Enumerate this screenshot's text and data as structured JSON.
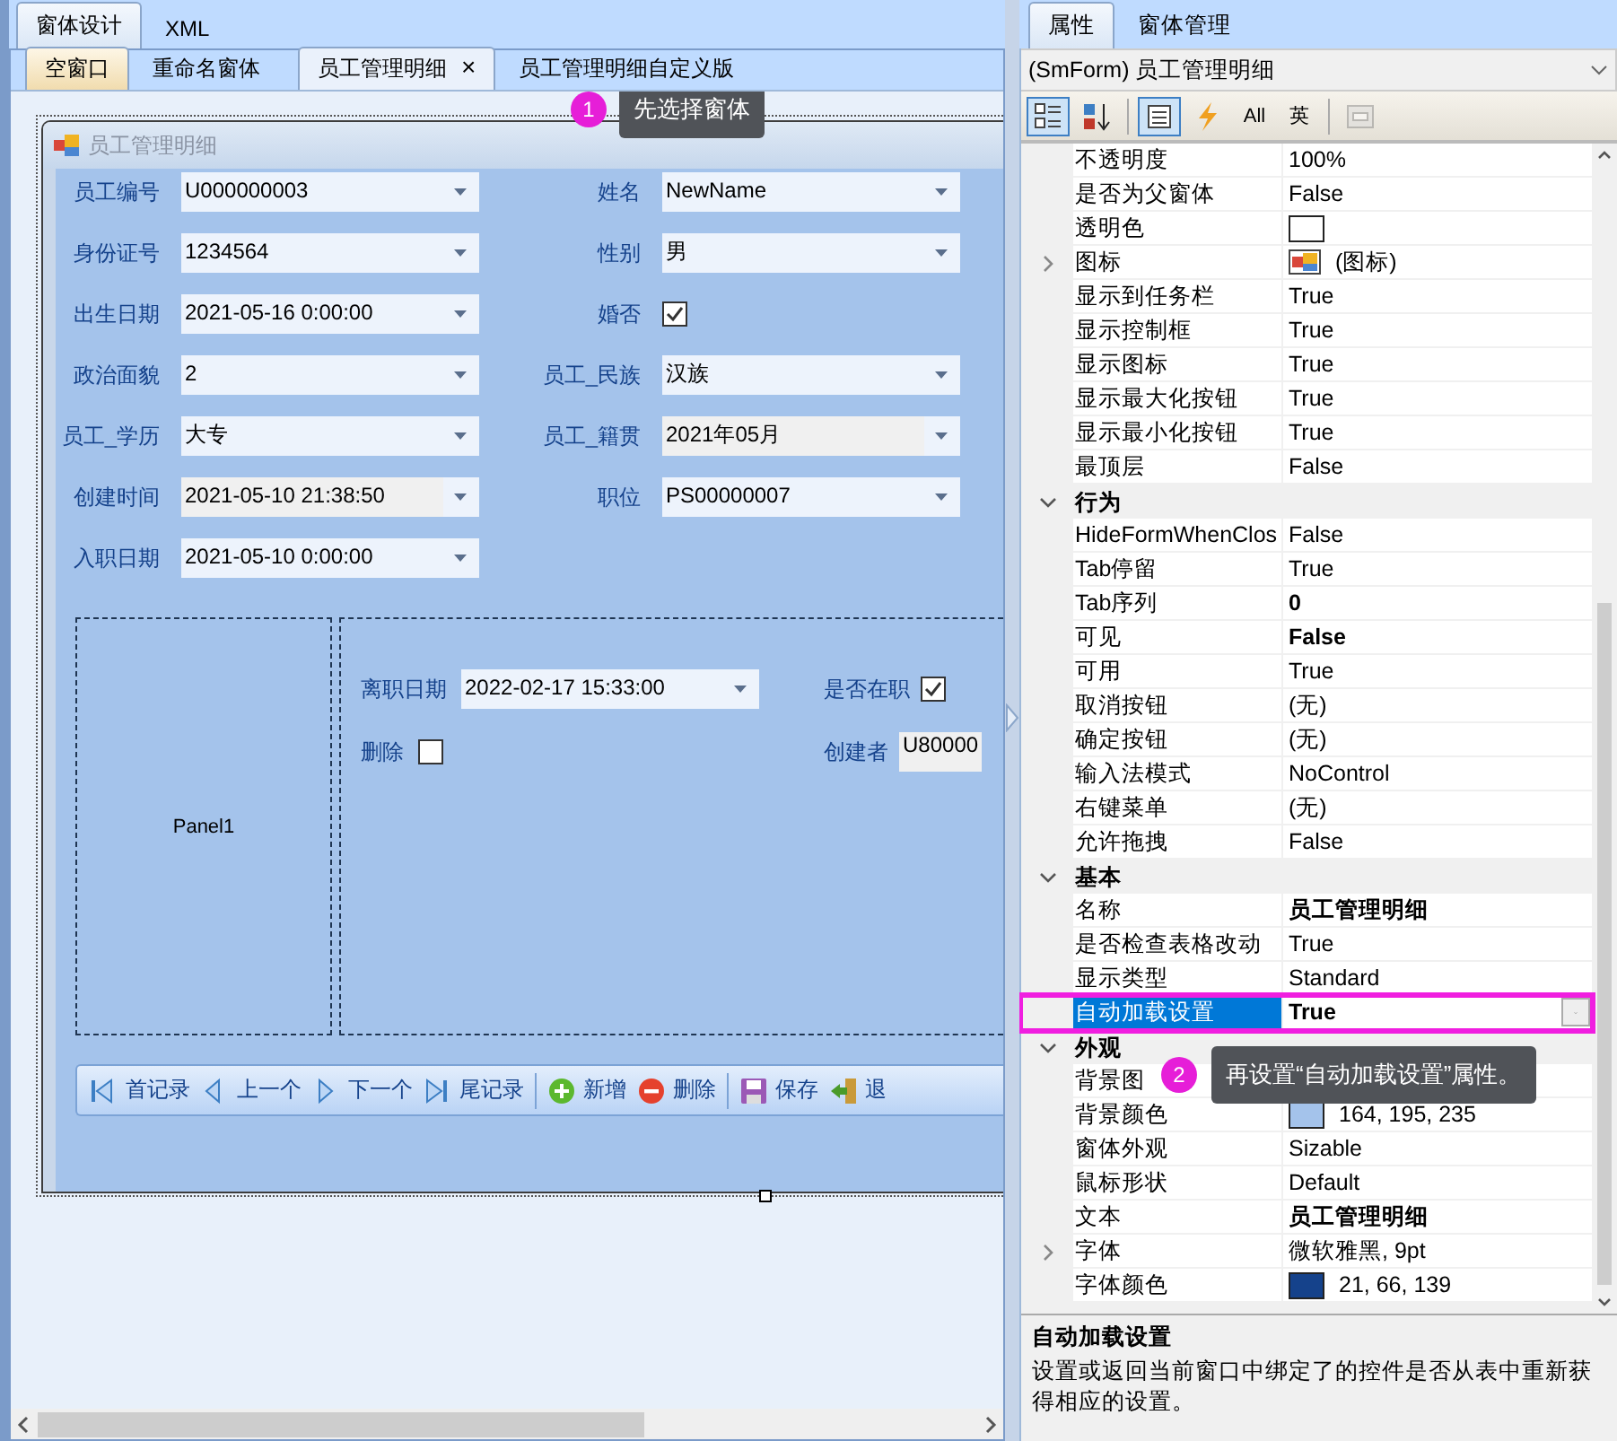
{
  "designer": {
    "tabs": [
      {
        "label": "窗体设计",
        "selected": true
      },
      {
        "label": "XML",
        "selected": false
      }
    ],
    "documents": [
      {
        "label": "空窗口",
        "selected": false,
        "highlighted": true,
        "closable": false
      },
      {
        "label": "重命名窗体",
        "selected": false,
        "highlighted": false,
        "closable": false
      },
      {
        "label": "员工管理明细",
        "selected": true,
        "highlighted": false,
        "closable": true,
        "close": "×"
      },
      {
        "label": "员工管理明细自定义版",
        "selected": false,
        "highlighted": false,
        "closable": false
      }
    ],
    "form": {
      "title": "员工管理明细",
      "rows": [
        [
          {
            "kind": "combo",
            "label": "员工编号",
            "value": "U000000003",
            "readonly": false
          },
          {
            "kind": "combo",
            "label": "姓名",
            "value": "NewName",
            "readonly": false
          }
        ],
        [
          {
            "kind": "combo",
            "label": "身份证号",
            "value": "1234564",
            "readonly": false
          },
          {
            "kind": "combo",
            "label": "性别",
            "value": "男",
            "readonly": false
          }
        ],
        [
          {
            "kind": "combo",
            "label": "出生日期",
            "value": "2021-05-16 0:00:00",
            "readonly": false
          },
          {
            "kind": "checkbox",
            "label": "婚否",
            "checked": true
          }
        ],
        [
          {
            "kind": "combo",
            "label": "政治面貌",
            "value": "2",
            "readonly": false
          },
          {
            "kind": "combo",
            "label": "员工_民族",
            "value": "汉族",
            "readonly": false
          }
        ],
        [
          {
            "kind": "combo",
            "label": "员工_学历",
            "value": "大专",
            "readonly": false
          },
          {
            "kind": "combo",
            "label": "员工_籍贯",
            "value": "2021年05月",
            "readonly": true
          }
        ],
        [
          {
            "kind": "combo",
            "label": "创建时间",
            "value": "2021-05-10 21:38:50",
            "readonly": true
          },
          {
            "kind": "combo",
            "label": "职位",
            "value": "PS00000007",
            "readonly": false
          }
        ],
        [
          {
            "kind": "combo",
            "label": "入职日期",
            "value": "2021-05-10 0:00:00",
            "readonly": false
          }
        ]
      ],
      "panel_caption": "Panel1",
      "panel_rows": [
        [
          {
            "kind": "combo",
            "label": "离职日期",
            "value": "2022-02-17 15:33:00",
            "readonly": false
          },
          {
            "kind": "checkbox",
            "label": "是否在职",
            "checked": true
          }
        ],
        [
          {
            "kind": "checkbox",
            "label": "删除",
            "checked": false
          },
          {
            "kind": "text",
            "label": "创建者",
            "value": "U80000",
            "readonly": true
          }
        ]
      ],
      "toolbar": [
        {
          "kind": "button",
          "label": "首记录"
        },
        {
          "kind": "button",
          "label": "上一个"
        },
        {
          "kind": "button",
          "label": "下一个"
        },
        {
          "kind": "button",
          "label": "尾记录"
        },
        {
          "kind": "separator"
        },
        {
          "kind": "button",
          "label": "新增"
        },
        {
          "kind": "button",
          "label": "删除"
        },
        {
          "kind": "separator"
        },
        {
          "kind": "button",
          "label": "保存"
        },
        {
          "kind": "button",
          "label": "退"
        }
      ]
    },
    "tip": {
      "badge": "1",
      "text": "先选择窗体"
    }
  },
  "properties": {
    "tabs": [
      {
        "label": "属性",
        "selected": true
      },
      {
        "label": "窗体管理",
        "selected": false
      }
    ],
    "selector": "(SmForm) 员工管理明细",
    "toolbar": [
      {
        "kind": "icon",
        "selected": true,
        "disabled": false
      },
      {
        "kind": "icon",
        "selected": false,
        "disabled": false
      },
      {
        "kind": "separator"
      },
      {
        "kind": "icon",
        "selected": true,
        "disabled": false
      },
      {
        "kind": "icon",
        "selected": false,
        "disabled": false
      },
      {
        "kind": "text",
        "label": "All",
        "selected": false,
        "disabled": false
      },
      {
        "kind": "text",
        "label": "英",
        "selected": false,
        "disabled": false
      },
      {
        "kind": "separator"
      },
      {
        "kind": "icon",
        "selected": false,
        "disabled": true
      }
    ],
    "grid": [
      {
        "kind": "property",
        "name": "不透明度",
        "value": "100%",
        "selected": false
      },
      {
        "kind": "property",
        "name": "是否为父窗体",
        "value": "False",
        "selected": false
      },
      {
        "kind": "property",
        "name": "透明色",
        "color": "#ffffff",
        "selected": false
      },
      {
        "kind": "property",
        "name": "图标",
        "value": "(图标)",
        "icon": true,
        "expandable": true,
        "selected": false
      },
      {
        "kind": "property",
        "name": "显示到任务栏",
        "value": "True",
        "selected": false
      },
      {
        "kind": "property",
        "name": "显示控制框",
        "value": "True",
        "selected": false
      },
      {
        "kind": "property",
        "name": "显示图标",
        "value": "True",
        "selected": false
      },
      {
        "kind": "property",
        "name": "显示最大化按钮",
        "value": "True",
        "selected": false
      },
      {
        "kind": "property",
        "name": "显示最小化按钮",
        "value": "True",
        "selected": false
      },
      {
        "kind": "property",
        "name": "最顶层",
        "value": "False",
        "selected": false
      },
      {
        "kind": "category",
        "name": "行为",
        "expanded": true
      },
      {
        "kind": "property",
        "name": "HideFormWhenClos",
        "value": "False",
        "selected": false
      },
      {
        "kind": "property",
        "name": "Tab停留",
        "value": "True",
        "selected": false
      },
      {
        "kind": "property",
        "name": "Tab序列",
        "value": "0",
        "bold": true,
        "selected": false
      },
      {
        "kind": "property",
        "name": "可见",
        "value": "False",
        "bold": true,
        "selected": false
      },
      {
        "kind": "property",
        "name": "可用",
        "value": "True",
        "selected": false
      },
      {
        "kind": "property",
        "name": "取消按钮",
        "value": "(无)",
        "selected": false
      },
      {
        "kind": "property",
        "name": "确定按钮",
        "value": "(无)",
        "selected": false
      },
      {
        "kind": "property",
        "name": "输入法模式",
        "value": "NoControl",
        "selected": false
      },
      {
        "kind": "property",
        "name": "右键菜单",
        "value": "(无)",
        "selected": false
      },
      {
        "kind": "property",
        "name": "允许拖拽",
        "value": "False",
        "selected": false
      },
      {
        "kind": "category",
        "name": "基本",
        "expanded": true
      },
      {
        "kind": "property",
        "name": "名称",
        "value": "员工管理明细",
        "bold": true,
        "selected": false
      },
      {
        "kind": "property",
        "name": "是否检查表格改动",
        "value": "True",
        "selected": false
      },
      {
        "kind": "property",
        "name": "显示类型",
        "value": "Standard",
        "selected": false
      },
      {
        "kind": "property",
        "name": "自动加载设置",
        "value": "True",
        "bold": true,
        "selected": true
      },
      {
        "kind": "category",
        "name": "外观",
        "expanded": true
      },
      {
        "kind": "property",
        "name": "背景图",
        "selected": false
      },
      {
        "kind": "property",
        "name": "背景颜色",
        "value": "164, 195, 235",
        "color": "#a4c3eb",
        "selected": false
      },
      {
        "kind": "property",
        "name": "窗体外观",
        "value": "Sizable",
        "selected": false
      },
      {
        "kind": "property",
        "name": "鼠标形状",
        "value": "Default",
        "selected": false
      },
      {
        "kind": "property",
        "name": "文本",
        "value": "员工管理明细",
        "bold": true,
        "selected": false
      },
      {
        "kind": "property",
        "name": "字体",
        "value": "微软雅黑, 9pt",
        "expandable": true,
        "selected": false
      },
      {
        "kind": "property",
        "name": "字体颜色",
        "value": "21, 66, 139",
        "color": "#15428b",
        "selected": false
      }
    ],
    "description": {
      "title": "自动加载设置",
      "text": "设置或返回当前窗口中绑定了的控件是否从表中重新获得相应的设置。"
    },
    "tip": {
      "badge": "2",
      "text": "再设置“自动加载设置”属性。"
    }
  }
}
